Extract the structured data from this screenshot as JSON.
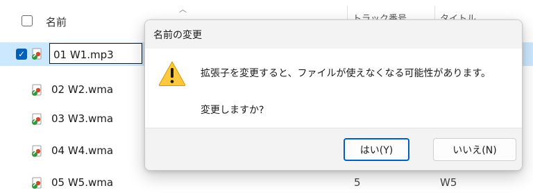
{
  "explorer": {
    "columns": {
      "name": "名前",
      "track": "トラック番号",
      "title": "タイトル"
    },
    "rename_value": "01 W1.mp3",
    "rows": [
      {
        "name": "01 W1.mp3",
        "track": "",
        "title": ""
      },
      {
        "name": "02 W2.wma",
        "track": "",
        "title": ""
      },
      {
        "name": "03 W3.wma",
        "track": "",
        "title": ""
      },
      {
        "name": "04 W4.wma",
        "track": "",
        "title": ""
      },
      {
        "name": "05 W5.wma",
        "track": "5",
        "title": "W5"
      }
    ]
  },
  "dialog": {
    "title": "名前の変更",
    "message": "拡張子を変更すると、ファイルが使えなくなる可能性があります。",
    "question": "変更しますか?",
    "yes_label": "はい(Y)",
    "no_label": "いいえ(N)"
  },
  "colors": {
    "selection": "#cce8ff",
    "accent": "#005fb8",
    "warning": "#ffc83d"
  },
  "icons": {
    "file": "media-file-icon",
    "warning": "warning-icon",
    "sort": "sort-asc-icon"
  }
}
